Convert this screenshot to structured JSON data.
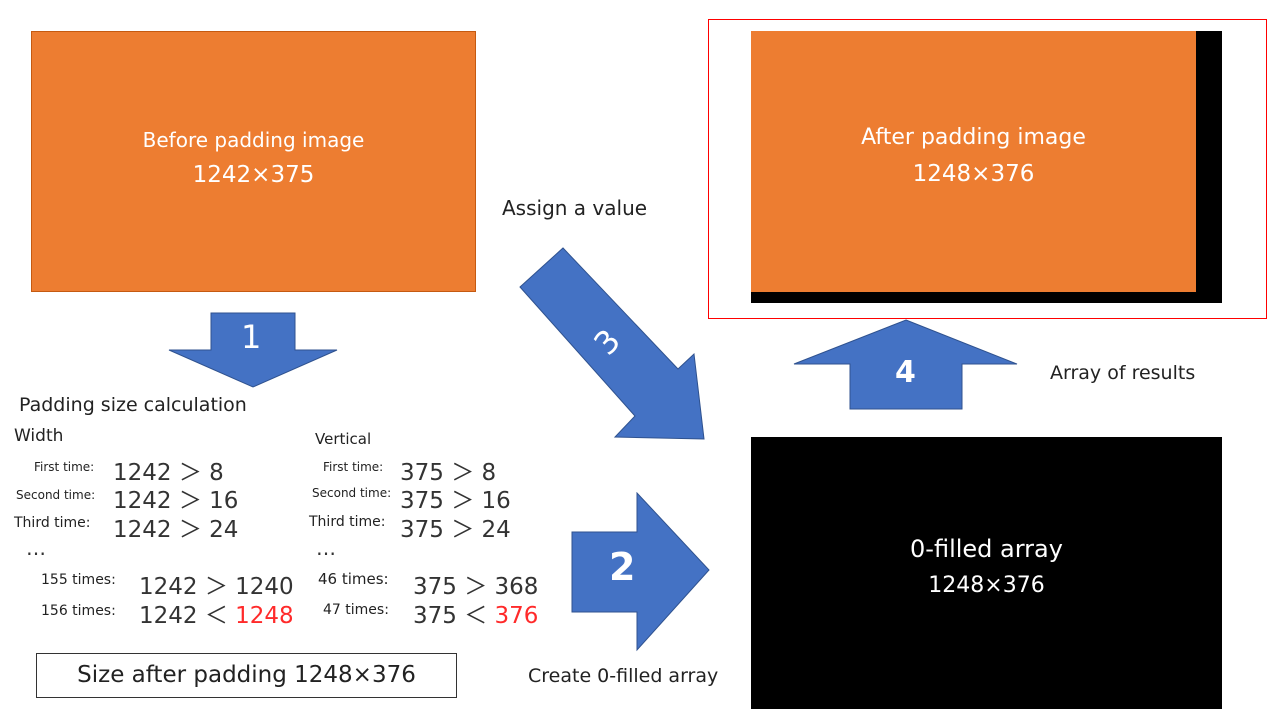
{
  "before_box": {
    "title": "Before padding image",
    "size": "1242×375"
  },
  "after_box": {
    "title": "After padding image",
    "size": "1248×376"
  },
  "zero_box": {
    "title": "0-filled array",
    "size": "1248×376"
  },
  "arrows": {
    "step1": "1",
    "step2": "2",
    "step3": "3",
    "step4": "4"
  },
  "labels": {
    "assign": "Assign a value",
    "create": "Create 0-filled array",
    "results": "Array of results",
    "padding_calc": "Padding size calculation",
    "width": "Width",
    "vertical": "Vertical"
  },
  "width_rows": [
    {
      "label": "First time:",
      "expr": "1242 ＞ 8",
      "highlight": ""
    },
    {
      "label": "Second time:",
      "expr": "1242 ＞ 16",
      "highlight": ""
    },
    {
      "label": "Third time:",
      "expr": "1242 ＞ 24",
      "highlight": ""
    },
    {
      "label": "155 times:",
      "expr": "1242 ＞ 1240",
      "highlight": ""
    },
    {
      "label": "156 times:",
      "expr": "1242 ＜ ",
      "highlight": "1248"
    }
  ],
  "vertical_rows": [
    {
      "label": "First time:",
      "expr": "375 ＞ 8",
      "highlight": ""
    },
    {
      "label": "Second time:",
      "expr": "375 ＞ 16",
      "highlight": ""
    },
    {
      "label": "Third time:",
      "expr": "375 ＞ 24",
      "highlight": ""
    },
    {
      "label": "46 times:",
      "expr": "375 ＞ 368",
      "highlight": ""
    },
    {
      "label": "47 times:",
      "expr": "375 ＜ ",
      "highlight": "376"
    }
  ],
  "ellipsis": "…",
  "result_box": {
    "text": "Size after padding 1248×376"
  },
  "colors": {
    "orange": "#ED7D31",
    "arrow_blue": "#4472C4",
    "highlight_red": "#FF0000",
    "black": "#000000"
  }
}
